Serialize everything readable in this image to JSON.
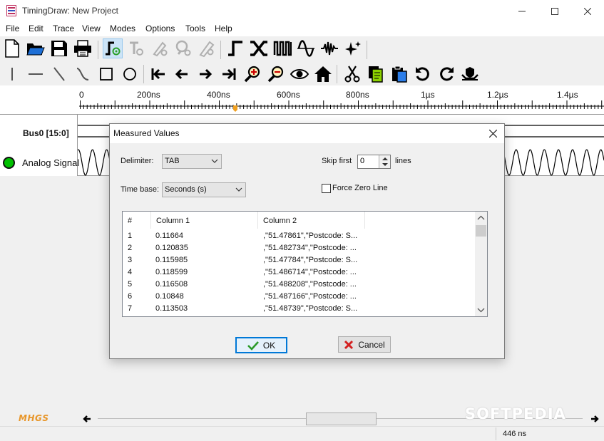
{
  "window": {
    "title": "TimingDraw: New Project"
  },
  "menu": [
    "File",
    "Edit",
    "Trace",
    "View",
    "Modes",
    "Options",
    "Tools",
    "Help"
  ],
  "toolbar1": [
    "new-file-icon",
    "open-folder-icon",
    "save-icon",
    "print-icon",
    "draw-mode-icon",
    "text-mode-icon",
    "pen-mode-icon",
    "zoom-mode-icon",
    "measure-mode-icon",
    "clock-signal-icon",
    "bus-signal-icon",
    "pulse-train-icon",
    "analog-wave-icon",
    "noise-wave-icon",
    "sparkle-icon"
  ],
  "toolbar2": [
    "vertical-line-icon",
    "horizontal-line-icon",
    "diagonal-line-icon",
    "curve-line-icon",
    "rectangle-icon",
    "circle-icon",
    "go-start-icon",
    "arrow-left-icon",
    "arrow-right-icon",
    "go-end-icon",
    "zoom-in-icon",
    "zoom-out-icon",
    "eye-icon",
    "home-icon",
    "cut-icon",
    "copy-icon",
    "paste-icon",
    "undo-icon",
    "redo-icon",
    "hands-icon"
  ],
  "ruler": {
    "labels": [
      "0",
      "200ns",
      "400ns",
      "600ns",
      "800ns",
      "1µs",
      "1.2µs",
      "1.4µs"
    ],
    "cursor_time": "446 ns"
  },
  "traces": [
    {
      "name": "Bus0 [15:0]",
      "type": "bus"
    },
    {
      "name": "Analog Signal",
      "type": "analog",
      "color": "#00c000"
    }
  ],
  "dialog": {
    "title": "Measured Values",
    "delimiter_label": "Delimiter:",
    "delimiter_value": "TAB",
    "timebase_label": "Time base:",
    "timebase_value": "Seconds (s)",
    "skip_label": "Skip first",
    "skip_value": "0",
    "skip_suffix": "lines",
    "force_zero_label": "Force Zero Line",
    "force_zero_checked": false,
    "columns": [
      "#",
      "Column 1",
      "Column 2"
    ],
    "rows": [
      [
        "1",
        "0.11664",
        ",\"51.47861\",\"Postcode: S..."
      ],
      [
        "2",
        "0.120835",
        ",\"51.482734\",\"Postcode: ..."
      ],
      [
        "3",
        "0.115985",
        ",\"51.47784\",\"Postcode: S..."
      ],
      [
        "4",
        "0.118599",
        ",\"51.486714\",\"Postcode: ..."
      ],
      [
        "5",
        "0.116508",
        ",\"51.488208\",\"Postcode: ..."
      ],
      [
        "6",
        "0.10848",
        ",\"51.487166\",\"Postcode: ..."
      ],
      [
        "7",
        "0.113503",
        ",\"51.48739\",\"Postcode: S..."
      ]
    ],
    "ok_label": "OK",
    "cancel_label": "Cancel"
  },
  "logo_text": "MHGS",
  "watermark": "SOFTPEDIA"
}
